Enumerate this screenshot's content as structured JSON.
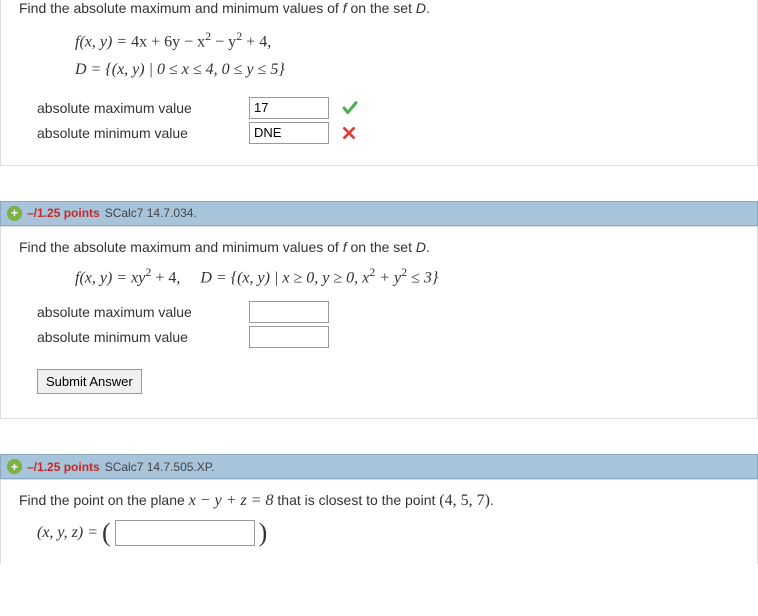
{
  "q1": {
    "prompt_before": "Find the absolute maximum and minimum values of ",
    "prompt_f": "f",
    "prompt_mid": " on the set ",
    "prompt_D": "D",
    "prompt_after": ".",
    "func_lhs": "f(x, y) = ",
    "func_rhs_plain": "4x + 6y − x",
    "func_rhs_after1": " − y",
    "func_rhs_after2": " + 4,",
    "domain": "D = {(x, y) | 0 ≤ x ≤ 4, 0 ≤ y ≤ 5}",
    "max_label": "absolute maximum value",
    "min_label": "absolute minimum value",
    "max_value": "17",
    "min_value": "DNE"
  },
  "q2": {
    "points": "–/1.25 points",
    "ref": "SCalc7 14.7.034.",
    "prompt_before": "Find the absolute maximum and minimum values of ",
    "prompt_f": "f",
    "prompt_mid": " on the set ",
    "prompt_D": "D",
    "prompt_after": ".",
    "func_lhs": "f(x, y) = xy",
    "func_rhs_after": " + 4,",
    "domain_lhs": "D = {(x, y) | x ≥ 0, y ≥ 0, x",
    "domain_mid": " + y",
    "domain_after": " ≤ 3}",
    "max_label": "absolute maximum value",
    "min_label": "absolute minimum value",
    "submit": "Submit Answer"
  },
  "q3": {
    "points": "–/1.25 points",
    "ref": "SCalc7 14.7.505.XP.",
    "prompt_before": "Find the point on the plane  ",
    "plane_eq": "x − y + z = 8",
    "prompt_mid": "  that is closest to the point  ",
    "point": "(4, 5, 7)",
    "prompt_after": ".",
    "answer_lhs": "(x, y, z) = "
  }
}
